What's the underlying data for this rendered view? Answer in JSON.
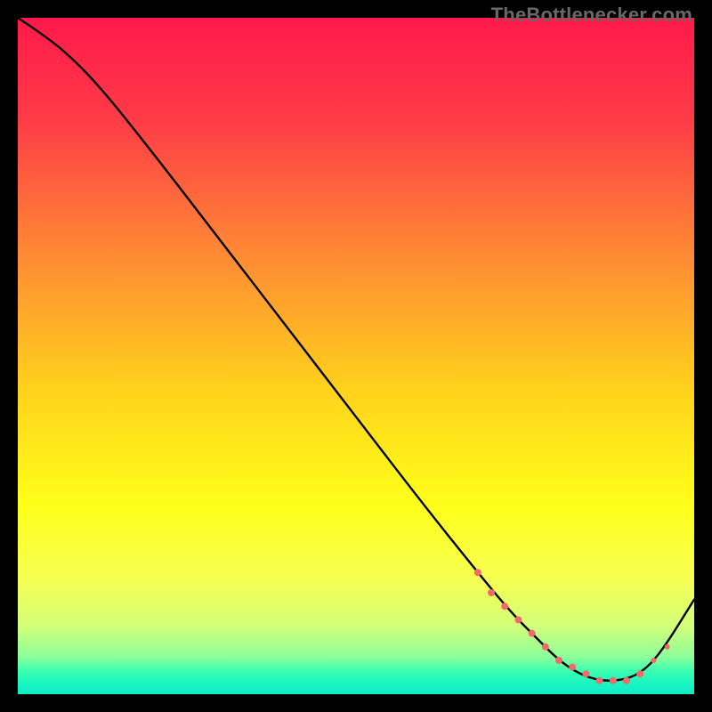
{
  "watermark": "TheBottlenecker.com",
  "chart_data": {
    "type": "line",
    "title": "",
    "xlabel": "",
    "ylabel": "",
    "xlim": [
      0,
      100
    ],
    "ylim": [
      0,
      100
    ],
    "gradient_stops": [
      {
        "offset": 0.0,
        "color": "#ff1a4b"
      },
      {
        "offset": 0.15,
        "color": "#ff3b47"
      },
      {
        "offset": 0.35,
        "color": "#ff8a34"
      },
      {
        "offset": 0.55,
        "color": "#ffd21c"
      },
      {
        "offset": 0.72,
        "color": "#ffff1a"
      },
      {
        "offset": 0.83,
        "color": "#f6ff52"
      },
      {
        "offset": 0.9,
        "color": "#d2ff7a"
      },
      {
        "offset": 0.945,
        "color": "#8cff9a"
      },
      {
        "offset": 0.965,
        "color": "#3dffb0"
      },
      {
        "offset": 0.985,
        "color": "#18f5c2"
      },
      {
        "offset": 1.0,
        "color": "#12e9c6"
      }
    ],
    "series": [
      {
        "name": "bottleneck-curve",
        "color": "#000000",
        "x": [
          0,
          3,
          7,
          12,
          20,
          30,
          40,
          50,
          60,
          68,
          73,
          77,
          80,
          83,
          86,
          89,
          92,
          95,
          100
        ],
        "values": [
          100,
          98,
          95,
          90,
          80,
          67,
          54,
          41,
          28,
          18,
          12,
          8,
          5,
          3,
          2,
          2,
          3,
          6,
          14
        ]
      }
    ],
    "markers": {
      "name": "selected-range",
      "color": "#ef6a6b",
      "x": [
        68,
        70,
        72,
        74,
        76,
        78,
        80,
        82,
        84,
        86,
        88,
        90,
        92,
        94,
        96
      ],
      "values": [
        18,
        15,
        13,
        11,
        9,
        7,
        5,
        4,
        3,
        2,
        2,
        2,
        3,
        5,
        7
      ],
      "radius": [
        4,
        4,
        4,
        4,
        4,
        4,
        4,
        4,
        4,
        4,
        4,
        4,
        4,
        3,
        3
      ]
    }
  }
}
